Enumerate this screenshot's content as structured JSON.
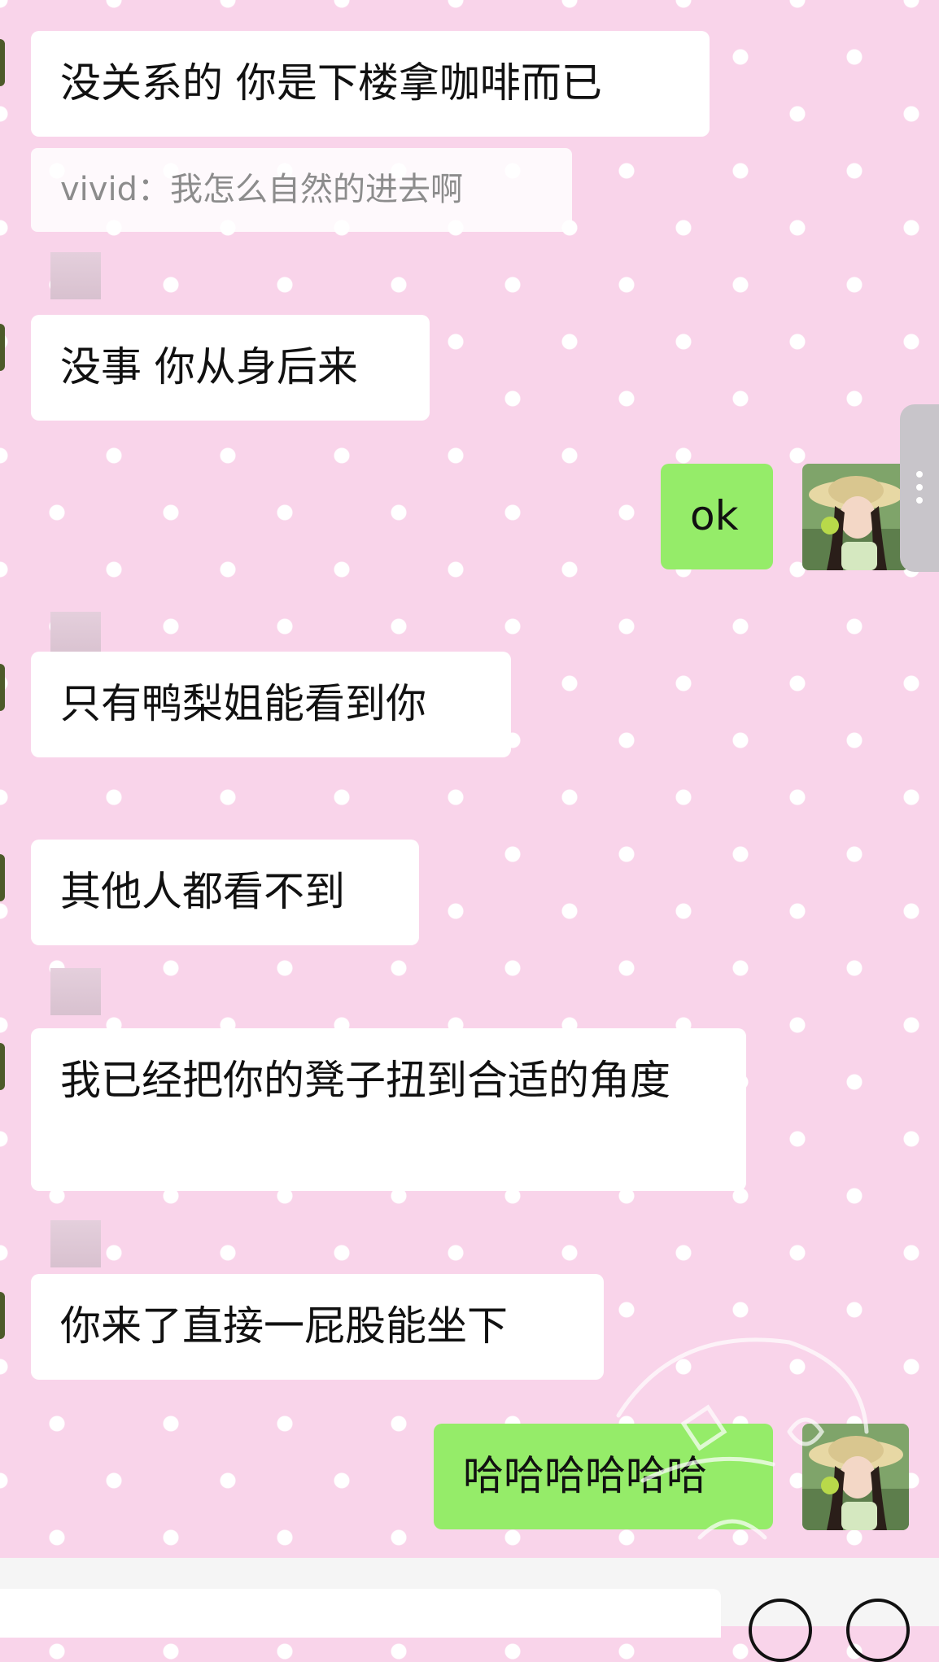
{
  "messages": [
    {
      "text": "没关系的 你是下楼拿咖啡而已"
    },
    {
      "text": "vivid：我怎么自然的进去啊"
    },
    {
      "text": "没事 你从身后来"
    },
    {
      "text": "ok"
    },
    {
      "text": "只有鸭梨姐能看到你"
    },
    {
      "text": "其他人都看不到"
    },
    {
      "text": "我已经把你的凳子扭到合适的角度"
    },
    {
      "text": "你来了直接一屁股能坐下"
    },
    {
      "text": "哈哈哈哈哈哈"
    }
  ],
  "colors": {
    "background": "#f9d4ea",
    "incoming_bubble": "#ffffff",
    "outgoing_bubble": "#95ec69"
  }
}
